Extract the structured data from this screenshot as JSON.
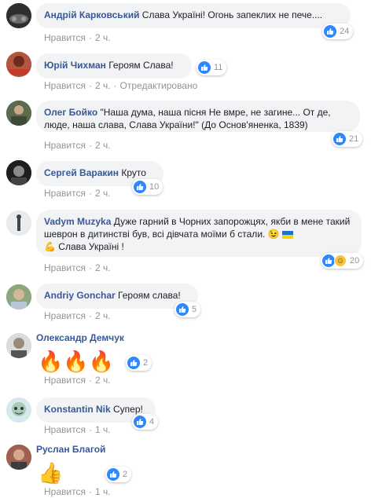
{
  "like_label": "Нравится",
  "comments": [
    {
      "author": "Андрій Карковський",
      "text": "Слава Україні! Огонь запеклих не пече....",
      "time": "2 ч.",
      "reactions": "24"
    },
    {
      "author": "Юрій Чихман",
      "text": "Героям Слава!",
      "time": "2 ч.",
      "edited": "Отредактировано",
      "reactions": "11"
    },
    {
      "author": "Олег Бойко",
      "text": "\"Наша дума, наша пісня Не вмре, не загине... От де, люде, наша слава, Слава України!\" (До Основ'яненка, 1839)",
      "time": "2 ч.",
      "reactions": "21"
    },
    {
      "author": "Сергей Варакин",
      "text": "Круто",
      "time": "2 ч.",
      "reactions": "10"
    },
    {
      "author": "Vadym Muzyka",
      "text": "Дуже гарний в Чорних запорожцях, якби в мене такий шеврон в дитинстві був, всі дівчата моїми б стали. 😉",
      "text2": "💪 Слава Україні !",
      "time": "2 ч.",
      "reactions": "20"
    },
    {
      "author": "Andriy Gonchar",
      "text": "Героям слава!",
      "time": "2 ч.",
      "reactions": "5"
    },
    {
      "author": "Олександр Демчук",
      "emoji": "🔥🔥🔥",
      "time": "2 ч.",
      "reactions": "2"
    },
    {
      "author": "Konstantin Nik",
      "text": "Супер!",
      "time": "1 ч.",
      "reactions": "4"
    },
    {
      "author": "Руслан Благой",
      "emoji": "👍",
      "time": "1 ч.",
      "reactions": "2"
    }
  ],
  "colors": {
    "link": "#385898",
    "bubble": "#f2f3f5",
    "meta": "#90949c",
    "like": "#2d88ff"
  }
}
